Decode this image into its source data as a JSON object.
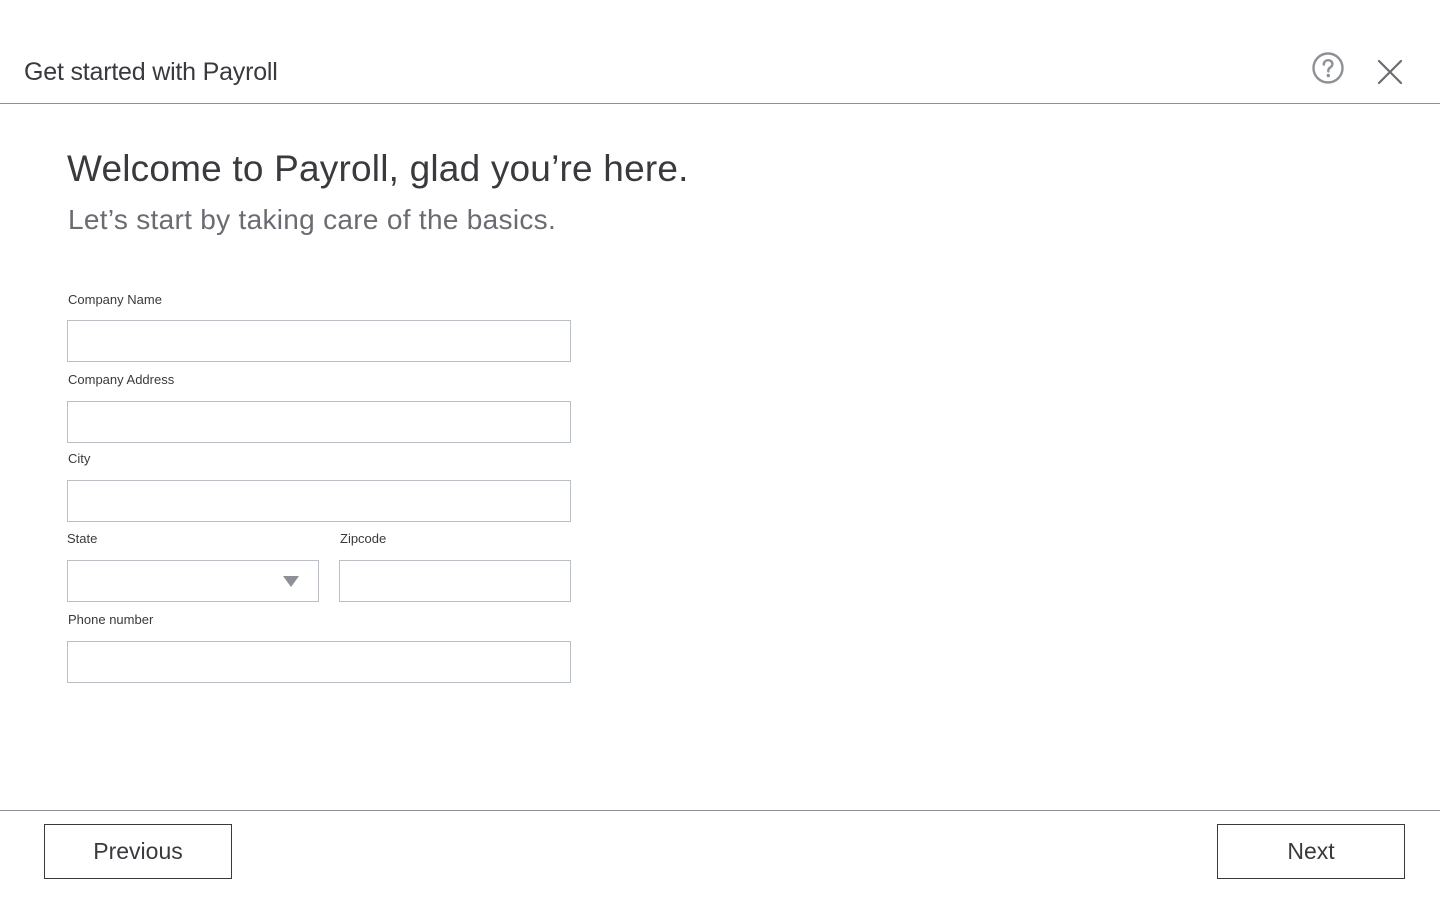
{
  "header": {
    "title": "Get started with Payroll",
    "help_icon": "help-circle-icon",
    "close_icon": "close-icon"
  },
  "welcome": {
    "title": "Welcome to Payroll, glad you’re here.",
    "subtitle": "Let’s start by taking care of the basics."
  },
  "form": {
    "company_name": {
      "label": "Company Name",
      "value": ""
    },
    "company_address": {
      "label": "Company Address",
      "value": ""
    },
    "city": {
      "label": "City",
      "value": ""
    },
    "state": {
      "label": "State",
      "selected": ""
    },
    "zipcode": {
      "label": "Zipcode",
      "value": ""
    },
    "phone": {
      "label": "Phone number",
      "value": ""
    }
  },
  "footer": {
    "previous_label": "Previous",
    "next_label": "Next"
  },
  "colors": {
    "text": "#393a3d",
    "subtle_text": "#6b6c72",
    "border": "#babec5",
    "divider": "#8d9096",
    "icon": "#8d9096"
  }
}
